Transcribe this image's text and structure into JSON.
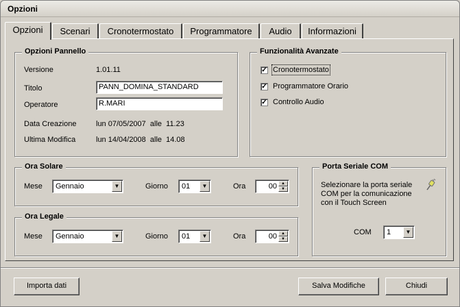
{
  "window": {
    "title": "Opzioni"
  },
  "tabs": [
    {
      "label": "Opzioni"
    },
    {
      "label": "Scenari"
    },
    {
      "label": "Cronotermostato"
    },
    {
      "label": "Programmatore"
    },
    {
      "label": "Audio"
    },
    {
      "label": "Informazioni"
    }
  ],
  "pannello": {
    "legend": "Opzioni Pannello",
    "versione_label": "Versione",
    "versione_value": "1.01.11",
    "titolo_label": "Titolo",
    "titolo_value": "PANN_DOMINA_STANDARD",
    "operatore_label": "Operatore",
    "operatore_value": "R.MARI",
    "creazione_label": "Data Creazione",
    "creazione_value": "lun 07/05/2007  alle  11.23",
    "modifica_label": "Ultima Modifica",
    "modifica_value": "lun 14/04/2008  alle  14.08"
  },
  "avanzate": {
    "legend": "Funzionalità Avanzate",
    "items": [
      {
        "label": "Cronotermostato",
        "checked": true
      },
      {
        "label": "Programmatore Orario",
        "checked": true
      },
      {
        "label": "Controllo Audio",
        "checked": true
      }
    ]
  },
  "ora_solare": {
    "legend": "Ora Solare",
    "mese_label": "Mese",
    "mese_value": "Gennaio",
    "giorno_label": "Giorno",
    "giorno_value": "01",
    "ora_label": "Ora",
    "ora_value": "00"
  },
  "ora_legale": {
    "legend": "Ora Legale",
    "mese_label": "Mese",
    "mese_value": "Gennaio",
    "giorno_label": "Giorno",
    "giorno_value": "01",
    "ora_label": "Ora",
    "ora_value": "00"
  },
  "porta": {
    "legend": "Porta Seriale COM",
    "description_1": "Selezionare la porta seriale",
    "description_2": "COM per la comunicazione",
    "description_3": "con il Touch Screen",
    "com_label": "COM",
    "com_value": "1",
    "icon": "serial-plug-icon"
  },
  "buttons": {
    "importa": "Importa dati",
    "salva": "Salva Modifiche",
    "chiudi": "Chiudi"
  }
}
